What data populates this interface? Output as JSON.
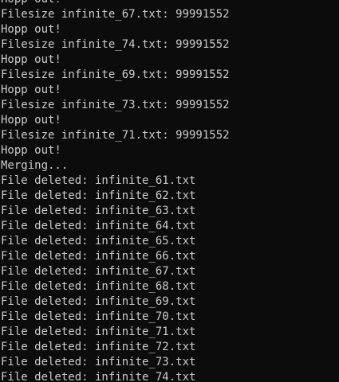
{
  "terminal": {
    "lines": [
      "Hopp out!",
      "Filesize infinite_67.txt: 99991552",
      "Hopp out!",
      "Filesize infinite_74.txt: 99991552",
      "Hopp out!",
      "Filesize infinite_69.txt: 99991552",
      "Hopp out!",
      "Filesize infinite_73.txt: 99991552",
      "Hopp out!",
      "Filesize infinite_71.txt: 99991552",
      "Hopp out!",
      "Merging...",
      "File deleted: infinite_61.txt",
      "File deleted: infinite_62.txt",
      "File deleted: infinite_63.txt",
      "File deleted: infinite_64.txt",
      "File deleted: infinite_65.txt",
      "File deleted: infinite_66.txt",
      "File deleted: infinite_67.txt",
      "File deleted: infinite_68.txt",
      "File deleted: infinite_69.txt",
      "File deleted: infinite_70.txt",
      "File deleted: infinite_71.txt",
      "File deleted: infinite_72.txt",
      "File deleted: infinite_73.txt",
      "File deleted: infinite_74.txt"
    ]
  }
}
